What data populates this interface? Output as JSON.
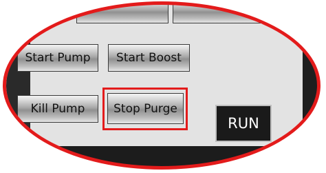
{
  "buttons": {
    "start_pump": "Start Pump",
    "start_boost": "Start Boost",
    "kill_pump": "Kill Pump",
    "stop_purge": "Stop Purge",
    "run": "RUN"
  },
  "colors": {
    "highlight": "#e31b1b",
    "panel": "#e3e3e3",
    "run_background": "#1a1a1a"
  }
}
